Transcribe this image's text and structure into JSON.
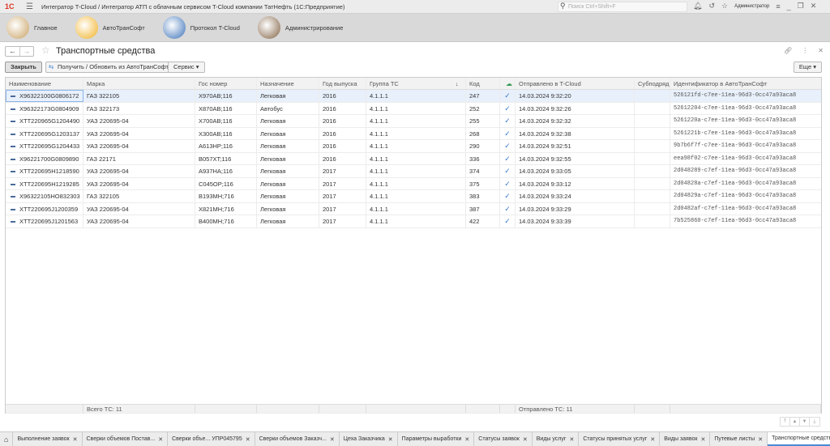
{
  "app": {
    "logo": "1С",
    "title": "Интегратор T-Cloud / Интегратор АТП с облачным сервисом T-Cloud компании ТатНефть  (1С:Предприятие)",
    "search_placeholder": "Поиск Ctrl+Shift+F",
    "user": "Администратор"
  },
  "sections": [
    {
      "label": "Главное",
      "color": "#c8a060"
    },
    {
      "label": "АвтоТранСофт",
      "color": "#f0b020"
    },
    {
      "label": "Протокол T-Cloud",
      "color": "#3a70b8"
    },
    {
      "label": "Администрирование",
      "color": "#806040"
    }
  ],
  "form": {
    "title": "Транспортные средства",
    "close_label": "Закрыть",
    "update_label": "Получить / Обновить из АвтоТранСофт",
    "service_label": "Сервис",
    "more_label": "Еще"
  },
  "table": {
    "headers": [
      "Наименование",
      "Марка",
      "Гос номер",
      "Назначение",
      "Год выпуска",
      "Группа ТС",
      "Код",
      "",
      "Отправлено в T-Cloud",
      "Субподряд",
      "Идентификатор в АвтоТранСофт"
    ],
    "sort_indicator": "↓",
    "rows": [
      [
        "X96322100G0806172",
        "ГАЗ 322105",
        "X970AB;116",
        "Легковая",
        "2016",
        "4.1.1.1",
        "247",
        "✓",
        "14.03.2024 9:32:20",
        "",
        "526121fd-c7ee-11ea-96d3-0cc47a93aca8"
      ],
      [
        "X96322173G0804909",
        "ГАЗ 322173",
        "X870AB;116",
        "Автобус",
        "2016",
        "4.1.1.1",
        "252",
        "✓",
        "14.03.2024 9:32:26",
        "",
        "52612204-c7ee-11ea-96d3-0cc47a93aca8"
      ],
      [
        "XTT220965G1204490",
        "УАЗ 220695-04",
        "X700AB;116",
        "Легковая",
        "2016",
        "4.1.1.1",
        "255",
        "✓",
        "14.03.2024 9:32:32",
        "",
        "5261220a-c7ee-11ea-96d3-0cc47a93aca8"
      ],
      [
        "XTT220695G1203137",
        "УАЗ 220695-04",
        "X300AB;116",
        "Легковая",
        "2016",
        "4.1.1.1",
        "268",
        "✓",
        "14.03.2024 9:32:38",
        "",
        "5261221b-c7ee-11ea-96d3-0cc47a93aca8"
      ],
      [
        "XTT220695G1204433",
        "УАЗ 220695-04",
        "A613HP;116",
        "Легковая",
        "2016",
        "4.1.1.1",
        "290",
        "✓",
        "14.03.2024 9:32:51",
        "",
        "9b7b6f7f-c7ee-11ea-96d3-0cc47a93aca8"
      ],
      [
        "X96221700G0809890",
        "ГАЗ 22171",
        "B057XT;116",
        "Легковая",
        "2016",
        "4.1.1.1",
        "336",
        "✓",
        "14.03.2024 9:32:55",
        "",
        "eea98f02-c7ee-11ea-96d3-0cc47a93aca8"
      ],
      [
        "XTT220695H1218590",
        "УАЗ 220695-04",
        "A937HA;116",
        "Легковая",
        "2017",
        "4.1.1.1",
        "374",
        "✓",
        "14.03.2024 9:33:05",
        "",
        "2d048289-c7ef-11ea-96d3-0cc47a93aca8"
      ],
      [
        "XTT220695H1219285",
        "УАЗ 220695-04",
        "C045OP;116",
        "Легковая",
        "2017",
        "4.1.1.1",
        "375",
        "✓",
        "14.03.2024 9:33:12",
        "",
        "2d04828a-c7ef-11ea-96d3-0cc47a93aca8"
      ],
      [
        "X96322105HO832303",
        "ГАЗ 322105",
        "B193MH;716",
        "Легковая",
        "2017",
        "4.1.1.1",
        "383",
        "✓",
        "14.03.2024 9:33:24",
        "",
        "2d04829a-c7ef-11ea-96d3-0cc47a93aca8"
      ],
      [
        "XTT220695J1200359",
        "УАЗ 220695-04",
        "X821MH;716",
        "Легковая",
        "2017",
        "4.1.1.1",
        "387",
        "✓",
        "14.03.2024 9:33:29",
        "",
        "2d0482af-c7ef-11ea-96d3-0cc47a93aca8"
      ],
      [
        "XTT220695J1201563",
        "УАЗ 220695-04",
        "B400MH;716",
        "Легковая",
        "2017",
        "4.1.1.1",
        "422",
        "✓",
        "14.03.2024 9:33:39",
        "",
        "7b525860-c7ef-11ea-96d3-0cc47a93aca8"
      ]
    ],
    "footer": {
      "total": "Всего ТС: 11",
      "sent": "Отправлено ТС: 11"
    }
  },
  "tabs": [
    "Выполнение заявок",
    "Сверки объемов Постав...",
    "Сверки объе... УПР045795",
    "Сверки объемов Заказч...",
    "Цеха Заказчика",
    "Параметры выработки",
    "Статусы заявок",
    "Виды услуг",
    "Статусы принятых услуг",
    "Виды заявок",
    "Путевые листы",
    "Транспортные средства"
  ],
  "active_tab": "Транспортные средства"
}
